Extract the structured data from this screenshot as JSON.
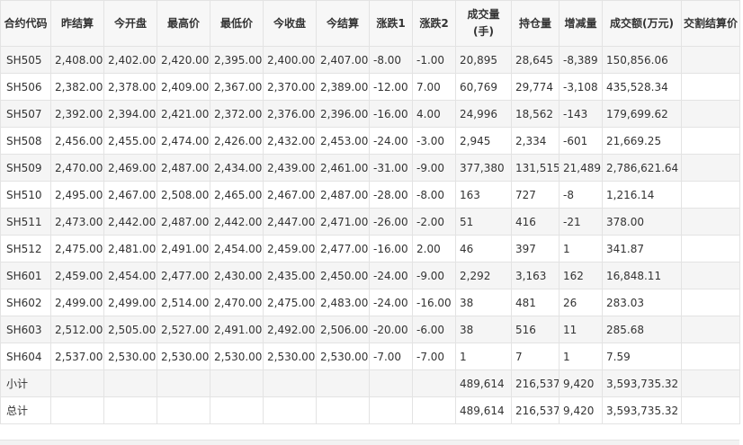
{
  "table": {
    "headers": [
      "合约代码",
      "昨结算",
      "今开盘",
      "最高价",
      "最低价",
      "今收盘",
      "今结算",
      "涨跌1",
      "涨跌2",
      "成交量(手)",
      "持仓量",
      "增减量",
      "成交额(万元)",
      "交割结算价"
    ],
    "rows": [
      [
        "SH505",
        "2,408.00",
        "2,402.00",
        "2,420.00",
        "2,395.00",
        "2,400.00",
        "2,407.00",
        "-8.00",
        "-1.00",
        "20,895",
        "28,645",
        "-8,389",
        "150,856.06",
        ""
      ],
      [
        "SH506",
        "2,382.00",
        "2,378.00",
        "2,409.00",
        "2,367.00",
        "2,370.00",
        "2,389.00",
        "-12.00",
        "7.00",
        "60,769",
        "29,774",
        "-3,108",
        "435,528.34",
        ""
      ],
      [
        "SH507",
        "2,392.00",
        "2,394.00",
        "2,421.00",
        "2,372.00",
        "2,376.00",
        "2,396.00",
        "-16.00",
        "4.00",
        "24,996",
        "18,562",
        "-143",
        "179,699.62",
        ""
      ],
      [
        "SH508",
        "2,456.00",
        "2,455.00",
        "2,474.00",
        "2,426.00",
        "2,432.00",
        "2,453.00",
        "-24.00",
        "-3.00",
        "2,945",
        "2,334",
        "-601",
        "21,669.25",
        ""
      ],
      [
        "SH509",
        "2,470.00",
        "2,469.00",
        "2,487.00",
        "2,434.00",
        "2,439.00",
        "2,461.00",
        "-31.00",
        "-9.00",
        "377,380",
        "131,515",
        "21,489",
        "2,786,621.64",
        ""
      ],
      [
        "SH510",
        "2,495.00",
        "2,467.00",
        "2,508.00",
        "2,465.00",
        "2,467.00",
        "2,487.00",
        "-28.00",
        "-8.00",
        "163",
        "727",
        "-8",
        "1,216.14",
        ""
      ],
      [
        "SH511",
        "2,473.00",
        "2,442.00",
        "2,487.00",
        "2,442.00",
        "2,447.00",
        "2,471.00",
        "-26.00",
        "-2.00",
        "51",
        "416",
        "-21",
        "378.00",
        ""
      ],
      [
        "SH512",
        "2,475.00",
        "2,481.00",
        "2,491.00",
        "2,454.00",
        "2,459.00",
        "2,477.00",
        "-16.00",
        "2.00",
        "46",
        "397",
        "1",
        "341.87",
        ""
      ],
      [
        "SH601",
        "2,459.00",
        "2,454.00",
        "2,477.00",
        "2,430.00",
        "2,435.00",
        "2,450.00",
        "-24.00",
        "-9.00",
        "2,292",
        "3,163",
        "162",
        "16,848.11",
        ""
      ],
      [
        "SH602",
        "2,499.00",
        "2,499.00",
        "2,514.00",
        "2,470.00",
        "2,475.00",
        "2,483.00",
        "-24.00",
        "-16.00",
        "38",
        "481",
        "26",
        "283.03",
        ""
      ],
      [
        "SH603",
        "2,512.00",
        "2,505.00",
        "2,527.00",
        "2,491.00",
        "2,492.00",
        "2,506.00",
        "-20.00",
        "-6.00",
        "38",
        "516",
        "11",
        "285.68",
        ""
      ],
      [
        "SH604",
        "2,537.00",
        "2,530.00",
        "2,530.00",
        "2,530.00",
        "2,530.00",
        "2,530.00",
        "-7.00",
        "-7.00",
        "1",
        "7",
        "1",
        "7.59",
        ""
      ],
      [
        "小计",
        "",
        "",
        "",
        "",
        "",
        "",
        "",
        "",
        "489,614",
        "216,537",
        "9,420",
        "3,593,735.32",
        ""
      ],
      [
        "总计",
        "",
        "",
        "",
        "",
        "",
        "",
        "",
        "",
        "489,614",
        "216,537",
        "9,420",
        "3,593,735.32",
        ""
      ]
    ]
  }
}
